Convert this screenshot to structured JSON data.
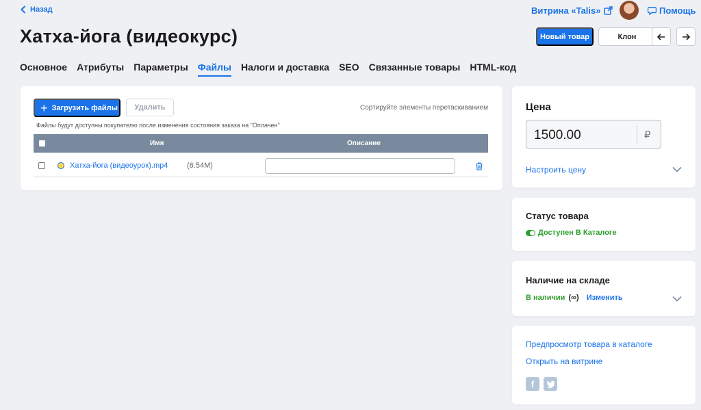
{
  "nav": {
    "back_label": "Назад"
  },
  "header": {
    "store_label": "Витрина «Talis»",
    "help_label": "Помощь",
    "title": "Хатха-йога (видеокурс)",
    "new_product_label": "Новый товар",
    "clone_label": "Клон"
  },
  "tabs": [
    {
      "label": "Основное",
      "active": false
    },
    {
      "label": "Атрибуты",
      "active": false
    },
    {
      "label": "Параметры",
      "active": false
    },
    {
      "label": "Файлы",
      "active": true
    },
    {
      "label": "Налоги и доставка",
      "active": false
    },
    {
      "label": "SEO",
      "active": false
    },
    {
      "label": "Связанные товары",
      "active": false
    },
    {
      "label": "HTML-код",
      "active": false
    }
  ],
  "files": {
    "upload_label": "Загрузить файлы",
    "delete_label": "Удалить",
    "sort_hint": "Сортируйте элементы перетаскиванием",
    "note": "Файлы будут доступны покупателю после изменения состояния заказа на \"Оплачен\"",
    "col_name": "Имя",
    "col_desc": "Описание",
    "rows": [
      {
        "name": "Хатха-йога (видеоурок).mp4",
        "size": "(6.54M)",
        "description": ""
      }
    ]
  },
  "price": {
    "heading": "Цена",
    "value": "1500.00",
    "currency": "₽",
    "configure_label": "Настроить цену"
  },
  "status": {
    "heading": "Статус товара",
    "value": "Доступен В Каталоге"
  },
  "stock": {
    "heading": "Наличие на складе",
    "value": "В наличии",
    "infinite": "(∞)",
    "change_label": "Изменить"
  },
  "links": {
    "preview_label": "Предпросмотр товара в каталоге",
    "open_label": "Открыть на витрине"
  },
  "colors": {
    "accent": "#1a73e8",
    "success": "#2e9e2e",
    "table_header": "#7a8a9e"
  }
}
